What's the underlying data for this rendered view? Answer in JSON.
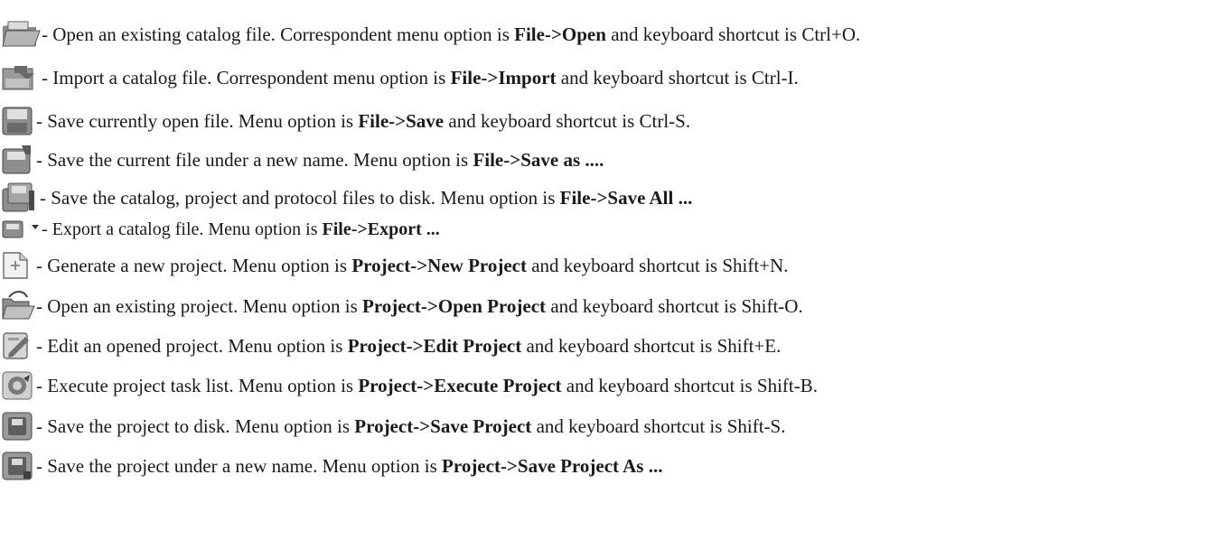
{
  "rows": [
    {
      "icon": "open-catalog-icon",
      "lead": "- ",
      "desc": "Open an existing catalog file. Correspondent menu option is ",
      "menu": "File->Open",
      "mid": " and keyboard shortcut is ",
      "shortcut": "Ctrl+O."
    },
    {
      "icon": "import-catalog-icon",
      "lead": " - ",
      "desc": "Import a catalog file. Correspondent menu option is ",
      "menu": "File->Import",
      "mid": " and keyboard shortcut is ",
      "shortcut": "Ctrl-I."
    },
    {
      "icon": "save-file-icon",
      "lead": "- ",
      "desc": "Save currently open file. Menu option is ",
      "menu": "File->Save",
      "mid": " and keyboard shortcut is ",
      "shortcut": "Ctrl-S."
    },
    {
      "icon": "save-as-icon",
      "lead": " - ",
      "desc": "Save the current file under a new name. Menu option is ",
      "menu": "File->Save as ....",
      "mid": "",
      "shortcut": ""
    },
    {
      "icon": "save-all-icon",
      "lead": "- ",
      "desc": "Save the catalog, project and protocol files to disk. Menu option is ",
      "menu": "File->Save All ...",
      "mid": "",
      "shortcut": ""
    },
    {
      "icon": "export-catalog-icon",
      "lead": " - ",
      "desc": "Export a catalog file. Menu option is ",
      "menu": "File->Export ...",
      "mid": "",
      "shortcut": ""
    },
    {
      "icon": "new-project-icon",
      "lead": "- ",
      "desc": "Generate a new project. Menu option is ",
      "menu": "Project->New Project",
      "mid": " and keyboard shortcut is ",
      "shortcut": "Shift+N."
    },
    {
      "icon": "open-project-icon",
      "lead": "- ",
      "desc": "Open an existing project. Menu option is ",
      "menu": "Project->Open Project",
      "mid": " and keyboard shortcut is ",
      "shortcut": "Shift-O."
    },
    {
      "icon": "edit-project-icon",
      "lead": "- ",
      "desc": "Edit an opened project. Menu option is ",
      "menu": "Project->Edit Project",
      "mid": " and keyboard shortcut is ",
      "shortcut": "Shift+E."
    },
    {
      "icon": "execute-project-icon",
      "lead": "- ",
      "desc": "Execute project task list. Menu option is ",
      "menu": "Project->Execute Project",
      "mid": " and keyboard shortcut is ",
      "shortcut": "Shift-B."
    },
    {
      "icon": "save-project-icon",
      "lead": "- ",
      "desc": "Save the project to disk. Menu option is ",
      "menu": "Project->Save Project",
      "mid": " and keyboard shortcut is ",
      "shortcut": "Shift-S."
    },
    {
      "icon": "save-project-as-icon",
      "lead": "- ",
      "desc": "Save the project under a new name. Menu option is ",
      "menu": "Project->Save Project As ...",
      "mid": "",
      "shortcut": ""
    }
  ]
}
